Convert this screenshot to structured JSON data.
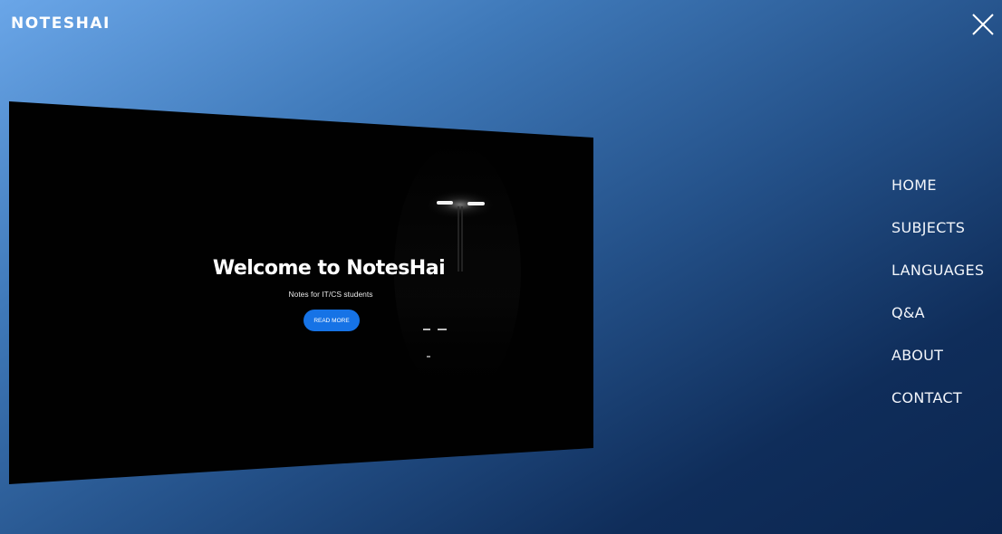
{
  "header": {
    "logo_text": "NOTESHAI",
    "close_icon": "close-icon"
  },
  "preview": {
    "title": "Welcome to NotesHai",
    "subtitle": "Notes for IT/CS students",
    "button_label": "READ MORE",
    "button_color": "#1673e6"
  },
  "nav": {
    "items": [
      {
        "label": "HOME"
      },
      {
        "label": "SUBJECTS"
      },
      {
        "label": "LANGUAGES"
      },
      {
        "label": "Q&A"
      },
      {
        "label": "ABOUT"
      },
      {
        "label": "CONTACT"
      }
    ]
  },
  "colors": {
    "background_start": "#6aa6e8",
    "background_end": "#0b2650",
    "text": "#ffffff"
  }
}
